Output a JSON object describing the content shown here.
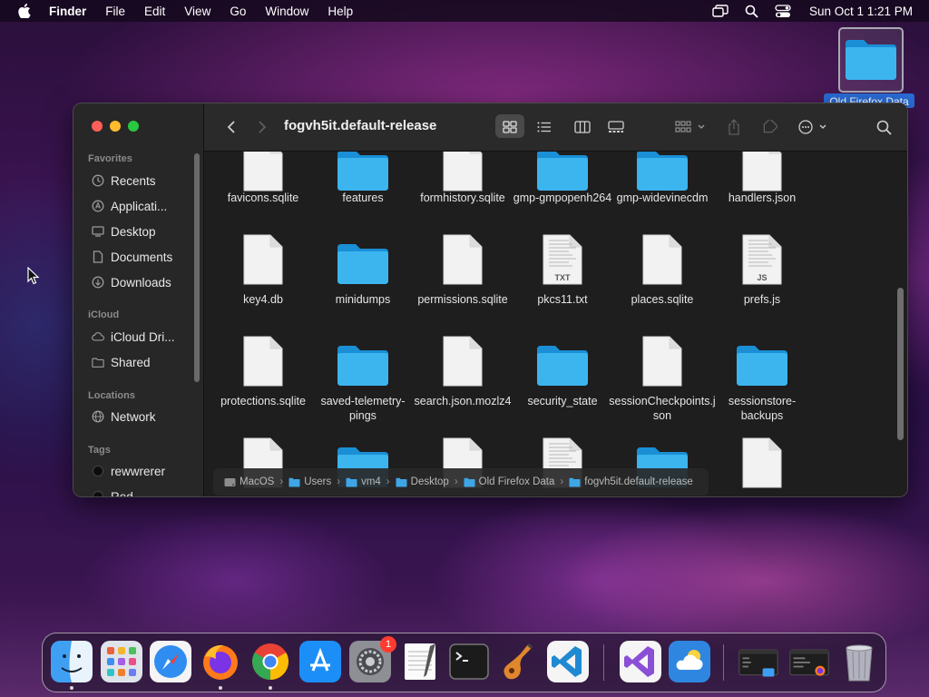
{
  "menubar": {
    "app_name": "Finder",
    "items": [
      "File",
      "Edit",
      "View",
      "Go",
      "Window",
      "Help"
    ],
    "clock": "Sun Oct 1  1:21 PM"
  },
  "desktop": {
    "folder_label": "Old Firefox Data"
  },
  "window": {
    "title": "fogvh5it.default-release",
    "sidebar": {
      "favorites_header": "Favorites",
      "favorites": [
        {
          "label": "Recents",
          "icon": "clock-icon"
        },
        {
          "label": "Applicati...",
          "icon": "applications-icon"
        },
        {
          "label": "Desktop",
          "icon": "desktop-icon"
        },
        {
          "label": "Documents",
          "icon": "document-icon"
        },
        {
          "label": "Downloads",
          "icon": "download-icon"
        }
      ],
      "icloud_header": "iCloud",
      "icloud": [
        {
          "label": "iCloud Dri...",
          "icon": "cloud-icon"
        },
        {
          "label": "Shared",
          "icon": "shared-folder-icon"
        }
      ],
      "locations_header": "Locations",
      "locations": [
        {
          "label": "Network",
          "icon": "network-icon"
        }
      ],
      "tags_header": "Tags",
      "tags": [
        {
          "label": "rewwrerer"
        },
        {
          "label": "Red"
        }
      ]
    },
    "files": [
      {
        "name": "favicons.sqlite",
        "type": "doc"
      },
      {
        "name": "features",
        "type": "folder"
      },
      {
        "name": "formhistory.sqlite",
        "type": "doc"
      },
      {
        "name": "gmp-gmpopenh264",
        "type": "folder"
      },
      {
        "name": "gmp-widevinecdm",
        "type": "folder"
      },
      {
        "name": "handlers.json",
        "type": "doc"
      },
      {
        "name": "key4.db",
        "type": "doc"
      },
      {
        "name": "minidumps",
        "type": "folder"
      },
      {
        "name": "permissions.sqlite",
        "type": "doc"
      },
      {
        "name": "pkcs11.txt",
        "type": "txt",
        "badge": "TXT"
      },
      {
        "name": "places.sqlite",
        "type": "doc"
      },
      {
        "name": "prefs.js",
        "type": "js",
        "badge": "JS"
      },
      {
        "name": "protections.sqlite",
        "type": "doc"
      },
      {
        "name": "saved-telemetry-pings",
        "type": "folder"
      },
      {
        "name": "search.json.mozlz4",
        "type": "doc"
      },
      {
        "name": "security_state",
        "type": "folder"
      },
      {
        "name": "sessionCheckpoints.json",
        "type": "doc"
      },
      {
        "name": "sessionstore-backups",
        "type": "folder"
      },
      {
        "name": "",
        "type": "doc"
      },
      {
        "name": "",
        "type": "folder"
      },
      {
        "name": "",
        "type": "doc"
      },
      {
        "name": "",
        "type": "txtgray"
      },
      {
        "name": "",
        "type": "folder"
      },
      {
        "name": "",
        "type": "doc"
      }
    ],
    "pathbar": [
      {
        "label": "MacOS",
        "icon": "disk-icon"
      },
      {
        "label": "Users",
        "icon": "folder-icon"
      },
      {
        "label": "vm4",
        "icon": "folder-icon"
      },
      {
        "label": "Desktop",
        "icon": "folder-icon"
      },
      {
        "label": "Old Firefox Data",
        "icon": "folder-icon"
      },
      {
        "label": "fogvh5it.default-release",
        "icon": "folder-icon"
      }
    ]
  },
  "dock": {
    "apps": [
      {
        "name": "Finder",
        "running": true
      },
      {
        "name": "Launchpad",
        "running": false
      },
      {
        "name": "Safari",
        "running": false
      },
      {
        "name": "Firefox",
        "running": true
      },
      {
        "name": "Google Chrome",
        "running": true
      },
      {
        "name": "App Store",
        "running": false
      },
      {
        "name": "System Settings",
        "running": false,
        "badge": "1"
      },
      {
        "name": "TextEdit",
        "running": false
      },
      {
        "name": "Terminal",
        "running": false
      },
      {
        "name": "GarageBand",
        "running": false
      },
      {
        "name": "Visual Studio Code",
        "running": false
      },
      {
        "name": "Visual Studio",
        "running": false
      },
      {
        "name": "Weather",
        "running": false
      },
      {
        "name": "Finder Window",
        "running": false
      },
      {
        "name": "Firefox Window",
        "running": false
      },
      {
        "name": "Trash",
        "running": false
      }
    ]
  }
}
